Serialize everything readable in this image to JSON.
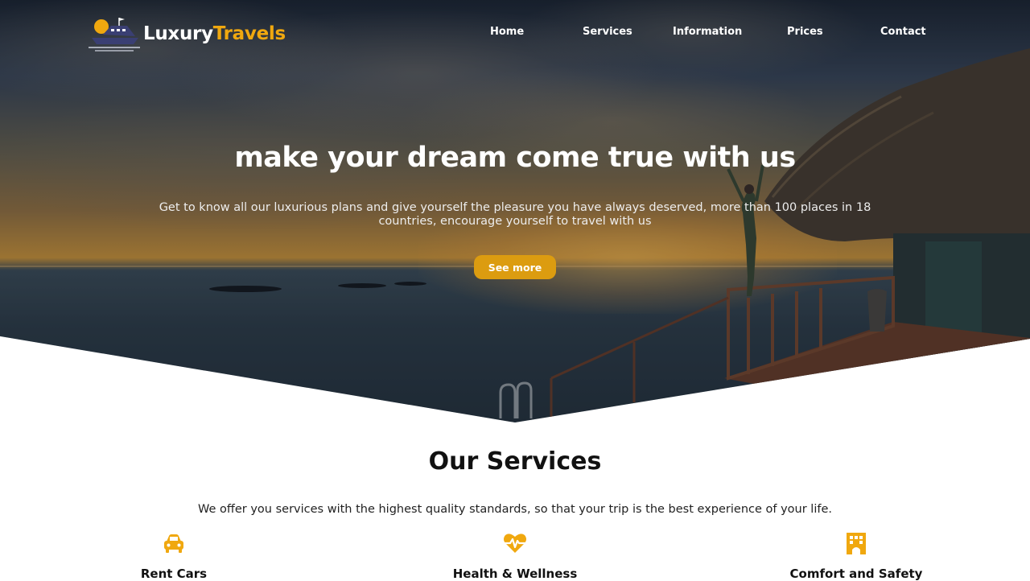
{
  "brand": {
    "name_part1": "Luxury",
    "name_part2": "Travels"
  },
  "nav": {
    "items": [
      {
        "label": "Home"
      },
      {
        "label": "Services"
      },
      {
        "label": "Information"
      },
      {
        "label": "Prices"
      },
      {
        "label": "Contact"
      }
    ]
  },
  "hero": {
    "title": "make your dream come true with us",
    "subtitle": "Get to know all our luxurious plans and give yourself the pleasure you have always deserved, more than 100 places in 18 countries, encourage yourself to travel with us",
    "cta_label": "See more"
  },
  "services": {
    "title": "Our Services",
    "subtitle": "We offer you services with the highest quality standards, so that your trip is the best experience of your life.",
    "items": [
      {
        "label": "Rent Cars",
        "icon": "car-icon"
      },
      {
        "label": "Health & Wellness",
        "icon": "heart-pulse-icon"
      },
      {
        "label": "Comfort and Safety",
        "icon": "hotel-building-icon"
      }
    ]
  },
  "colors": {
    "accent": "#f0a80f",
    "button": "#dc9c10",
    "text_dark": "#111111"
  }
}
